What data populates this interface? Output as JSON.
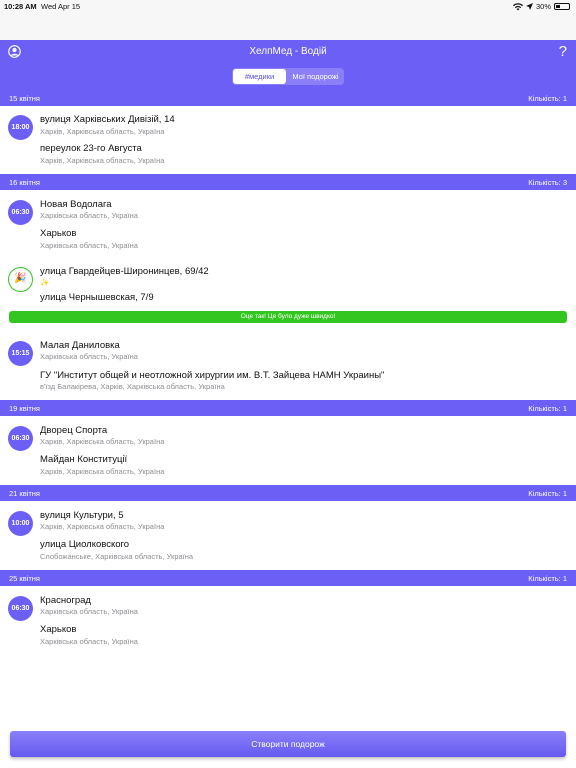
{
  "status": {
    "time": "10:28 AM",
    "date": "Wed Apr 15",
    "battery": "30%",
    "battery_level": 0.3
  },
  "header": {
    "title": "ХелпМед - Водій",
    "help": "?"
  },
  "tabs": [
    "#медики",
    "Мої подорожі"
  ],
  "sections": [
    {
      "date": "15 квітня",
      "count": "Кількість: 1"
    },
    {
      "date": "16 квітня",
      "count": "Кількість: 3"
    },
    {
      "date": "19 квітня",
      "count": "Кількість: 1"
    },
    {
      "date": "21 квітня",
      "count": "Кількість: 1"
    },
    {
      "date": "25 квітня",
      "count": "Кількість: 1"
    }
  ],
  "trips": [
    {
      "time": "18:00",
      "from": "вулиця Харківських Дивізій, 14",
      "from_sub": "Харків, Харківська область, Україна",
      "to": "переулок 23-го Августа",
      "to_sub": "Харків, Харківська область, Україна"
    },
    {
      "time": "06:30",
      "from": "Новая Водолага",
      "from_sub": "Харківська область, Україна",
      "to": "Харьков",
      "to_sub": "Харківська область, Україна"
    },
    {
      "icon": "🎉",
      "from": "улица Гвардейцев-Широнинцев, 69/42",
      "from_sub": "✨",
      "to": "улица Чернышевская, 7/9",
      "to_sub": ""
    },
    {
      "time": "15:15",
      "from": "Малая Даниловка",
      "from_sub": "Харківська область, Україна",
      "to": "ГУ \"Институт общей и неотложной хирургии им. В.Т. Зайцева НАМН Украины\"",
      "to_sub": "в'їзд Балакірева, Харків, Харківська область, Україна"
    },
    {
      "time": "06:30",
      "from": "Дворец Спорта",
      "from_sub": "Харків, Харківська область, Україна",
      "to": "Майдан Конституції",
      "to_sub": "Харків, Харківська область, Україна"
    },
    {
      "time": "10:00",
      "from": "вулиця Культури, 5",
      "from_sub": "Харків, Харківська область, Україна",
      "to": "улица Циолковского",
      "to_sub": "Слобожанське, Харківська область, Україна"
    },
    {
      "time": "06:30",
      "from": "Красноград",
      "from_sub": "Харківська область, Україна",
      "to": "Харьков",
      "to_sub": "Харківська область, Україна"
    }
  ],
  "banner": "Оце так! Це було дуже швидко!",
  "create_button": "Створити подорож"
}
